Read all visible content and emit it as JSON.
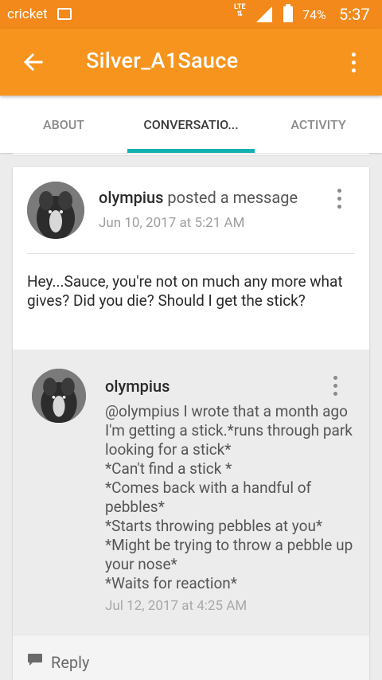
{
  "status_bar": {
    "carrier": "cricket",
    "network": "LTE",
    "battery": "74%",
    "time": "5:37",
    "icons": [
      "image-icon",
      "signal-icon",
      "battery-icon"
    ]
  },
  "app_bar": {
    "title": "Silver_A1Sauce",
    "back_icon": "arrow-left-icon",
    "menu_icon": "more-vertical-icon"
  },
  "tabs": [
    {
      "label": "ABOUT",
      "active": false
    },
    {
      "label": "CONVERSATIO...",
      "active": true
    },
    {
      "label": "ACTIVITY",
      "active": false
    }
  ],
  "post": {
    "username": "olympius",
    "action": "posted a message",
    "date": "Jun 10, 2017 at 5:21 AM",
    "body": "Hey...Sauce, you're not on much any more what gives? Did you die? Should I get the stick?"
  },
  "reply": {
    "username": "olympius",
    "lines": [
      "@olympius I wrote that a month ago I'm getting a stick.*runs through park looking for a stick*",
      "*Can't find a stick *",
      "*Comes back with a handful of pebbles*",
      "*Starts throwing pebbles at you*",
      "*Might be trying to throw a pebble up your nose*",
      "*Waits for reaction*"
    ],
    "date": "Jul 12, 2017 at 4:25 AM"
  },
  "reply_bar": {
    "label": "Reply",
    "icon": "chat-bubble-icon"
  },
  "colors": {
    "status_bar": "#f2891a",
    "app_bar": "#f7941d",
    "tab_indicator": "#14b1b1",
    "background": "#ececec"
  }
}
